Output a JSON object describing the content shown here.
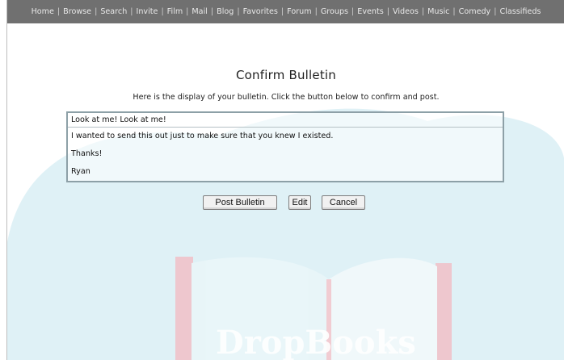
{
  "nav": {
    "items": [
      "Home",
      "Browse",
      "Search",
      "Invite",
      "Film",
      "Mail",
      "Blog",
      "Favorites",
      "Forum",
      "Groups",
      "Events",
      "Videos",
      "Music",
      "Comedy",
      "Classifieds"
    ],
    "separator": "|"
  },
  "page": {
    "title": "Confirm Bulletin",
    "subtitle": "Here is the display of your bulletin. Click the button below to confirm and post."
  },
  "bulletin": {
    "subject": "Look at me! Look at me!",
    "body_lines": [
      "I wanted to send this out just to make sure that you knew I existed.",
      "Thanks!",
      "Ryan"
    ]
  },
  "buttons": {
    "post": "Post Bulletin",
    "edit": "Edit",
    "cancel": "Cancel"
  },
  "background": {
    "logo_text": "DropBooks",
    "colors": {
      "light_blue": "#dff1f6",
      "navbar": "#707070",
      "book_pink": "#f3c9cf"
    }
  }
}
